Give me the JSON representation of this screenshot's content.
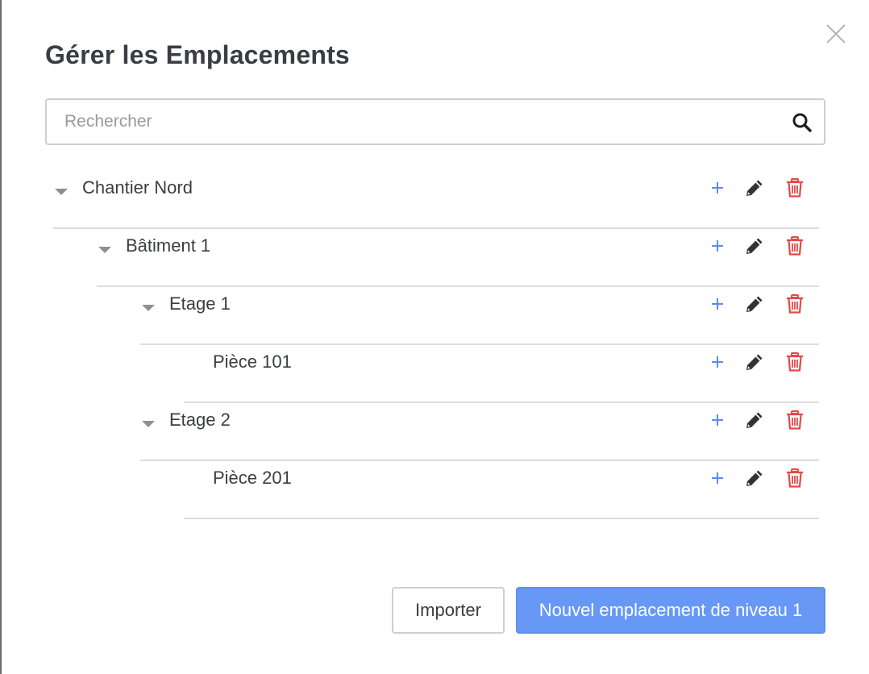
{
  "dialog": {
    "title": "Gérer les Emplacements",
    "search_placeholder": "Rechercher"
  },
  "tree": [
    {
      "label": "Chantier Nord",
      "level": 1,
      "expanded": true,
      "has_children": true
    },
    {
      "label": "Bâtiment 1",
      "level": 2,
      "expanded": true,
      "has_children": true
    },
    {
      "label": "Etage 1",
      "level": 3,
      "expanded": true,
      "has_children": true
    },
    {
      "label": "Pièce 101",
      "level": 4,
      "expanded": false,
      "has_children": false
    },
    {
      "label": "Etage 2",
      "level": 3,
      "expanded": true,
      "has_children": true
    },
    {
      "label": "Pièce 201",
      "level": 4,
      "expanded": false,
      "has_children": false
    }
  ],
  "row_actions": [
    "plus-icon",
    "pencil-icon",
    "trash-icon"
  ],
  "footer": {
    "import_label": "Importer",
    "new_label": "Nouvel emplacement de niveau 1"
  },
  "colors": {
    "accent": "#6898f6",
    "add_icon": "#5b8def",
    "edit_icon": "#333333",
    "delete_icon": "#e64848",
    "text": "#3a3d42",
    "border": "#dddddd"
  }
}
